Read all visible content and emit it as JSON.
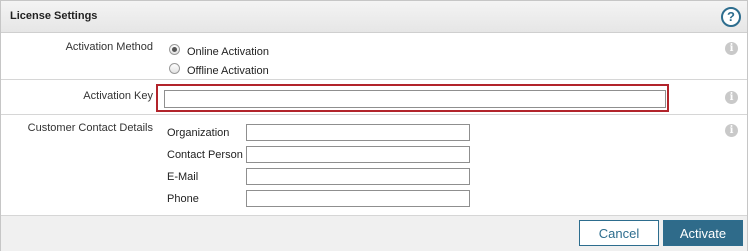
{
  "header": {
    "title": "License Settings",
    "help_icon": "?"
  },
  "activation_method": {
    "label": "Activation Method",
    "options": [
      {
        "label": "Online Activation",
        "selected": true
      },
      {
        "label": "Offline Activation",
        "selected": false
      }
    ]
  },
  "activation_key": {
    "label": "Activation Key",
    "value": ""
  },
  "contact": {
    "label": "Customer Contact Details",
    "fields": [
      {
        "label": "Organization",
        "value": ""
      },
      {
        "label": "Contact Person",
        "value": ""
      },
      {
        "label": "E-Mail",
        "value": ""
      },
      {
        "label": "Phone",
        "value": ""
      }
    ]
  },
  "info_icon_glyph": "i",
  "footer": {
    "cancel_label": "Cancel",
    "activate_label": "Activate"
  },
  "colors": {
    "accent": "#2f6b8a",
    "highlight_border": "#b2242b"
  }
}
